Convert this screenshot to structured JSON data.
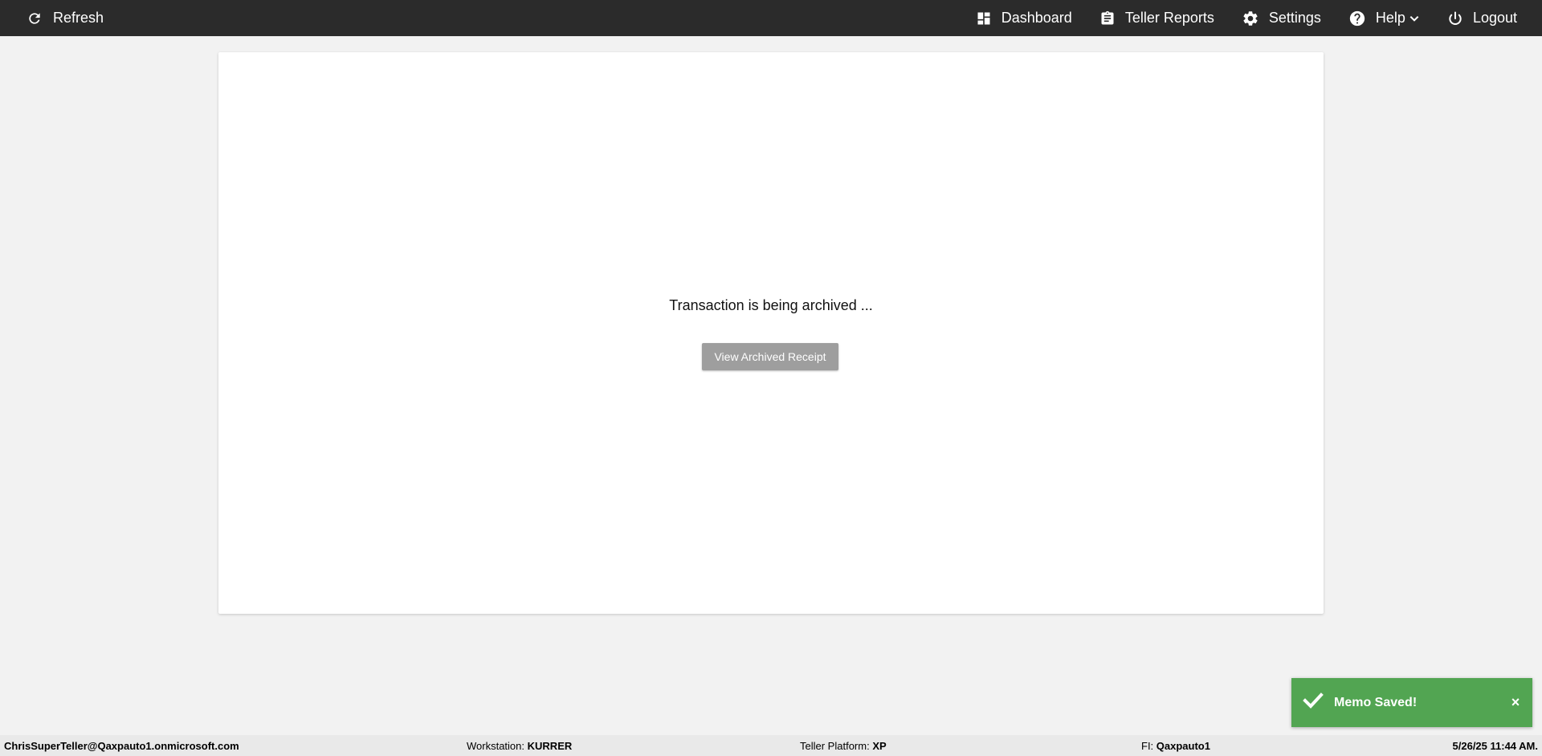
{
  "topbar": {
    "refresh_label": "Refresh",
    "dashboard_label": "Dashboard",
    "teller_reports_label": "Teller Reports",
    "settings_label": "Settings",
    "help_label": "Help",
    "logout_label": "Logout"
  },
  "main": {
    "status_message": "Transaction is being archived ...",
    "view_receipt_label": "View Archived Receipt"
  },
  "toast": {
    "message": "Memo Saved!",
    "close_label": "×"
  },
  "footer": {
    "user": "ChrisSuperTeller@Qaxpauto1.onmicrosoft.com",
    "workstation_label": "Workstation:",
    "workstation_value": "KURRER",
    "platform_label": "Teller Platform:",
    "platform_value": "XP",
    "fi_label": "FI:",
    "fi_value": "Qaxpauto1",
    "datetime": "5/26/25 11:44 AM."
  },
  "colors": {
    "topbar_bg": "#2b2b2b",
    "page_bg": "#f2f2f2",
    "toast_bg": "#52a552",
    "button_disabled": "#9e9e9e"
  },
  "icons": [
    "refresh-icon",
    "dashboard-icon",
    "clipboard-icon",
    "gear-icon",
    "help-icon",
    "chevron-down-icon",
    "power-icon",
    "check-icon"
  ]
}
